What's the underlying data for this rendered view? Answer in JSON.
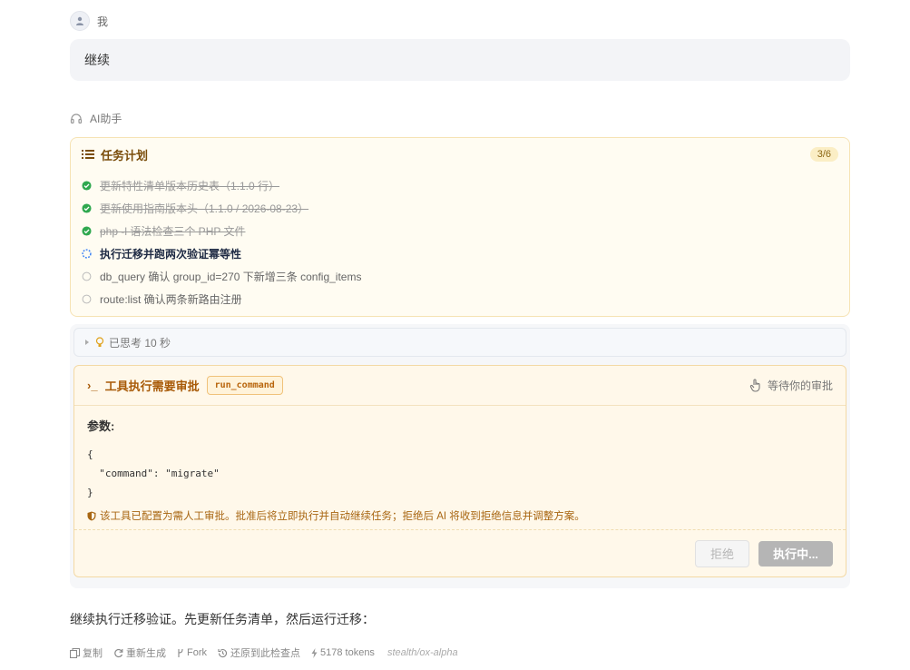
{
  "user": {
    "role_label": "我",
    "message": "继续"
  },
  "assistant": {
    "role_label": "AI助手"
  },
  "plan": {
    "title": "任务计划",
    "count": "3/6",
    "items": [
      {
        "text": "更新特性清单版本历史表（1.1.0 行）",
        "status": "done"
      },
      {
        "text": "更新使用指南版本头（1.1.0 / 2026-08-23）",
        "status": "done"
      },
      {
        "text": "php -l 语法检查三个 PHP 文件",
        "status": "done"
      },
      {
        "text": "执行迁移并跑两次验证幂等性",
        "status": "active"
      },
      {
        "text": "db_query 确认 group_id=270 下新增三条 config_items",
        "status": "pending"
      },
      {
        "text": "route:list 确认两条新路由注册",
        "status": "pending"
      }
    ]
  },
  "thinking": {
    "label": "已思考 10 秒"
  },
  "tool": {
    "prompt_symbol": "›_",
    "title": "工具执行需要审批",
    "command_name": "run_command",
    "waiting_label": "等待你的审批",
    "params_label": "参数:",
    "code_lines": [
      "{",
      "  \"command\": \"migrate\"",
      "}"
    ],
    "note": "该工具已配置为需人工审批。批准后将立即执行并自动继续任务；拒绝后 AI 将收到拒绝信息并调整方案。",
    "reject_label": "拒绝",
    "execute_label": "执行中..."
  },
  "reply": "继续执行迁移验证。先更新任务清单，然后运行迁移：",
  "actions": {
    "copy": "复制",
    "regenerate": "重新生成",
    "fork": "Fork",
    "restore": "还原到此检查点",
    "tokens": "5178 tokens",
    "model": "stealth/ox-alpha"
  },
  "colors": {
    "done": "#2fa84f",
    "active": "#3b82f6",
    "accent": "#a85a08"
  }
}
